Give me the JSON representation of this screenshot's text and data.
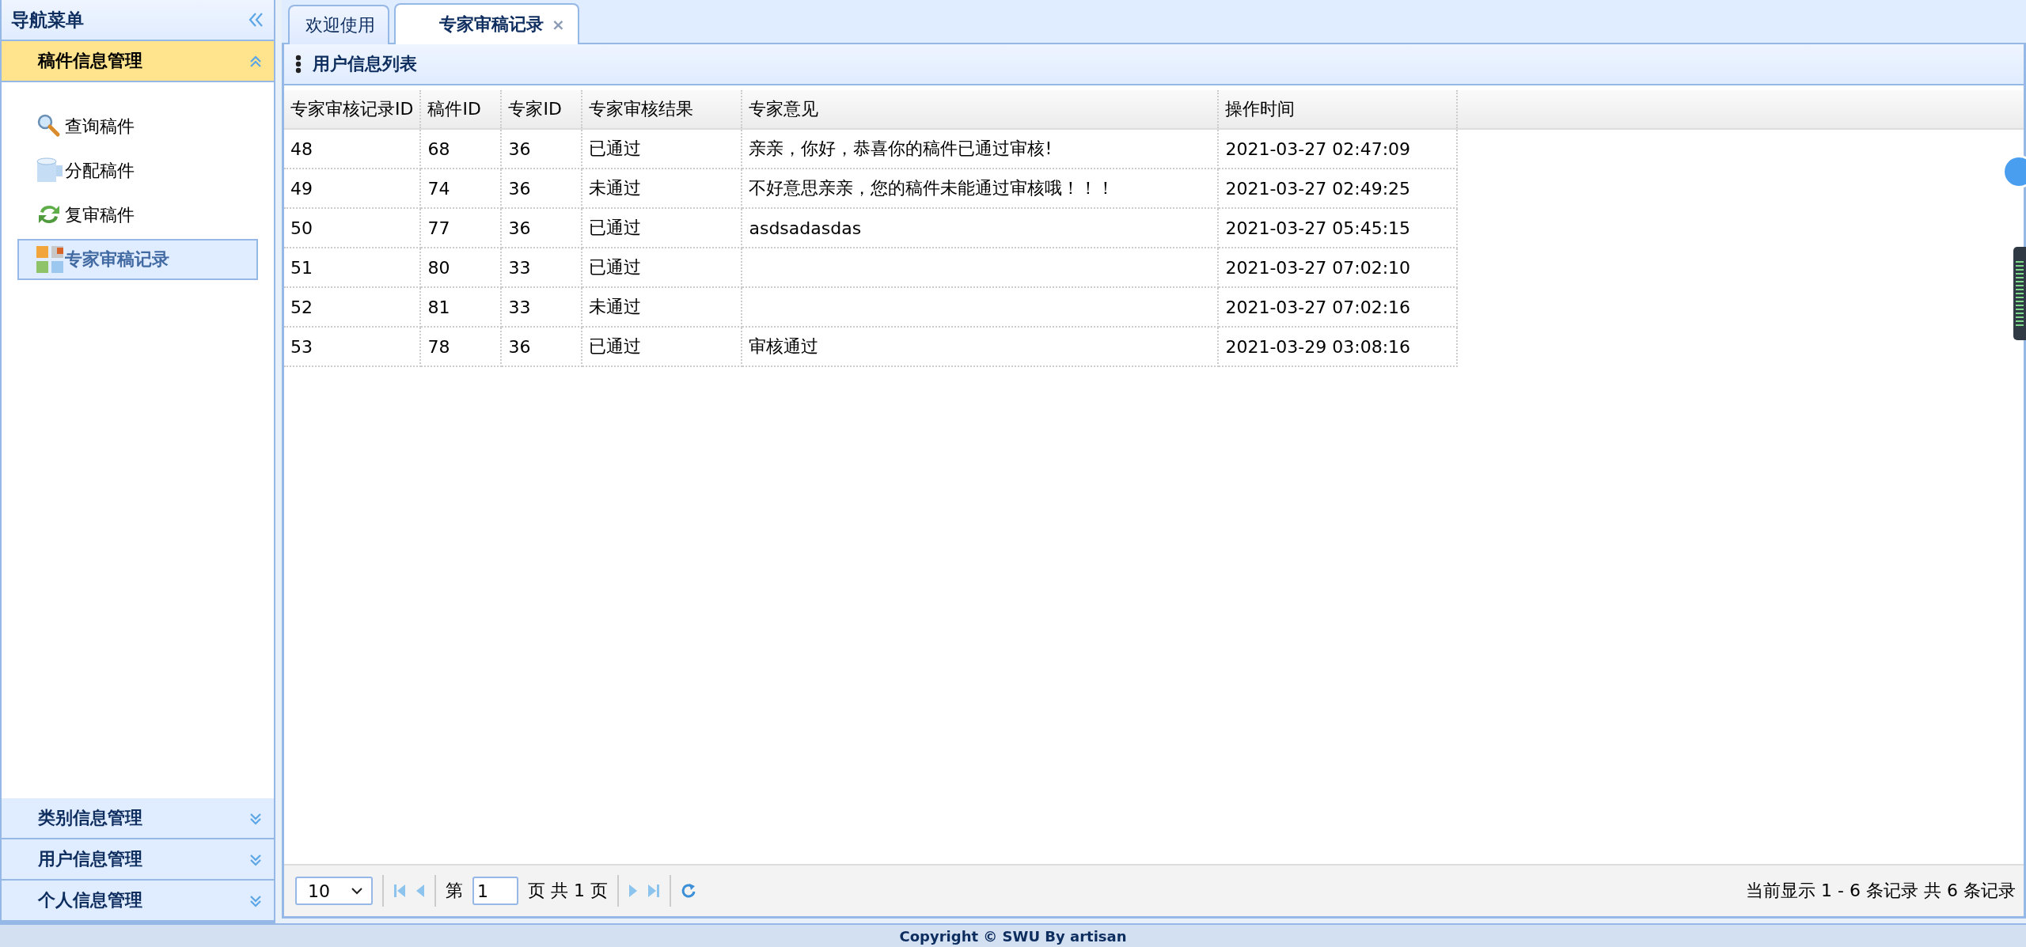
{
  "sidebar": {
    "title": "导航菜单",
    "groups": [
      {
        "label": "稿件信息管理",
        "expanded": true,
        "items": [
          {
            "label": "查询稿件",
            "kind": "search",
            "selected": false
          },
          {
            "label": "分配稿件",
            "kind": "database",
            "selected": false
          },
          {
            "label": "复审稿件",
            "kind": "refresh",
            "selected": false
          },
          {
            "label": "专家审稿记录",
            "kind": "grid",
            "selected": true
          }
        ]
      },
      {
        "label": "类别信息管理",
        "expanded": false
      },
      {
        "label": "用户信息管理",
        "expanded": false
      },
      {
        "label": "个人信息管理",
        "expanded": false
      }
    ]
  },
  "tabs": [
    {
      "label": "欢迎使用",
      "selected": false
    },
    {
      "label": "专家审稿记录",
      "selected": true,
      "close": "×"
    }
  ],
  "panel": {
    "title": "用户信息列表"
  },
  "table": {
    "columns": [
      "专家审核记录ID",
      "稿件ID",
      "专家ID",
      "专家审核结果",
      "专家意见",
      "操作时间"
    ],
    "rows": [
      [
        "48",
        "68",
        "36",
        "已通过",
        "亲亲，你好，恭喜你的稿件已通过审核!",
        "2021-03-27 02:47:09"
      ],
      [
        "49",
        "74",
        "36",
        "未通过",
        "不好意思亲亲，您的稿件未能通过审核哦！！！",
        "2021-03-27 02:49:25"
      ],
      [
        "50",
        "77",
        "36",
        "已通过",
        "asdsadasdas",
        "2021-03-27 05:45:15"
      ],
      [
        "51",
        "80",
        "33",
        "已通过",
        null,
        "2021-03-27 07:02:10"
      ],
      [
        "52",
        "81",
        "33",
        "未通过",
        null,
        "2021-03-27 07:02:16"
      ],
      [
        "53",
        "78",
        "36",
        "已通过",
        "审核通过",
        "2021-03-29 03:08:16"
      ]
    ]
  },
  "pager": {
    "page_size": "10",
    "page_prefix": "第",
    "page": "1",
    "page_suffix": "页 共 1 页",
    "summary": "当前显示 1 - 6 条记录 共 6 条记录"
  },
  "footer": "Copyright © SWU By artisan"
}
